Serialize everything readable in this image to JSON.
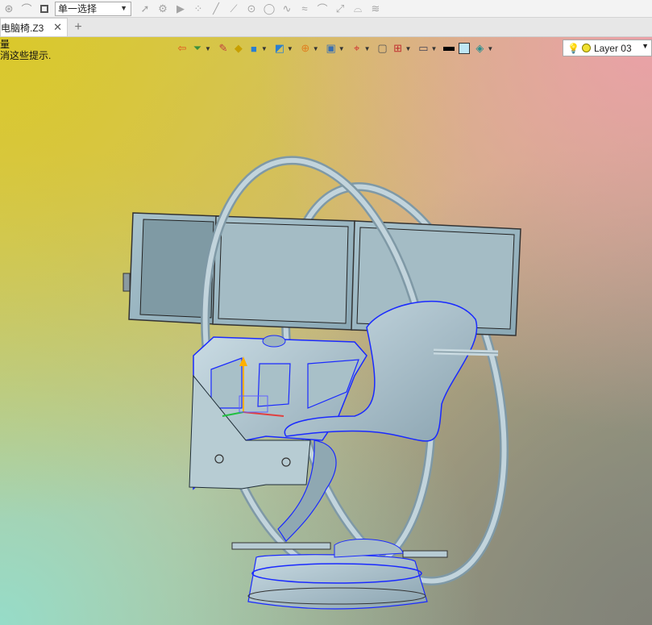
{
  "toolbar": {
    "select_mode": "单一选择",
    "icons": [
      "pick-filter-icon",
      "pick-mode-icon",
      "stop-icon",
      "cursor-icon",
      "pick-entity-icon",
      "play-icon",
      "point-cloud-icon",
      "line-icon",
      "segment-icon",
      "circle-center-icon",
      "circle-icon",
      "curve-icon",
      "spline-icon",
      "arc-icon",
      "edit-curve-icon",
      "hat-icon",
      "layer-stack-icon"
    ]
  },
  "tabs": {
    "doc_title": "电脑椅.Z3",
    "new_tab": "+"
  },
  "viewport": {
    "hint_line1": "量",
    "hint_line2": "消这些提示."
  },
  "view_toolbar": {
    "layer_name": "Layer 03",
    "colors": {
      "black_swatch": "#000000",
      "light_swatch": "#bfe6f4",
      "accent": "#2a3aff"
    }
  }
}
